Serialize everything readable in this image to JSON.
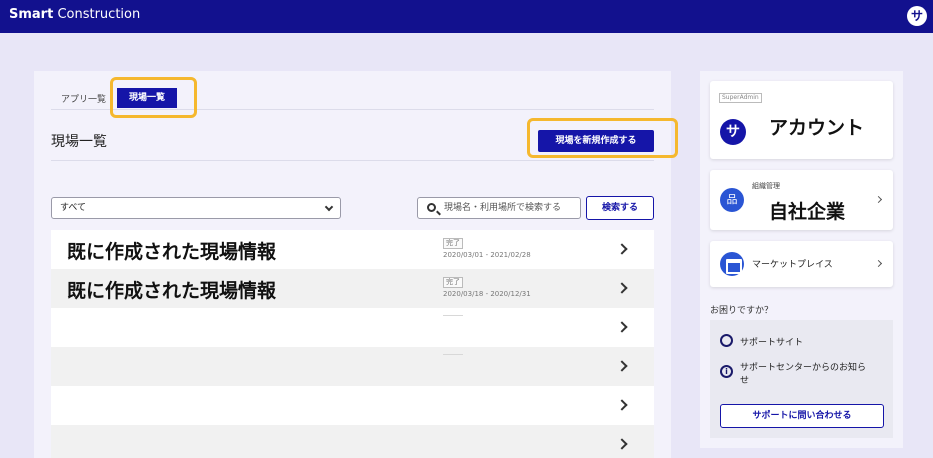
{
  "header": {
    "brand_bold": "Smart",
    "brand_rest": " Construction",
    "icon_char": "サ"
  },
  "tabs": [
    {
      "label": "アプリ一覧",
      "active": false
    },
    {
      "label": "現場一覧",
      "active": true
    }
  ],
  "page": {
    "title": "現場一覧",
    "create_button": "現場を新規作成する"
  },
  "filters": {
    "select_value": "すべて",
    "search_placeholder": "現場名・利用場所で検索する",
    "search_button": "検索する"
  },
  "sites": [
    {
      "name": "既に作成された現場情報",
      "status": "完了",
      "date_range": "2020/03/01 - 2021/02/28"
    },
    {
      "name": "既に作成された現場情報",
      "status": "完了",
      "date_range": "2020/03/18 - 2020/12/31"
    },
    {
      "name": "",
      "status": "",
      "date_range": ""
    },
    {
      "name": "",
      "status": "",
      "date_range": ""
    },
    {
      "name": "",
      "status": "",
      "date_range": ""
    },
    {
      "name": "",
      "status": "",
      "date_range": ""
    }
  ],
  "sidebar": {
    "account": {
      "role_badge": "SuperAdmin",
      "avatar_char": "サ",
      "name": "アカウント"
    },
    "org": {
      "label": "組織管理",
      "name": "自社企業",
      "icon_char": "品"
    },
    "marketplace": {
      "label": "マーケットプレイス"
    },
    "help": {
      "title": "お困りですか？",
      "support_site": "サポートサイト",
      "notice_line1": "サポートセンターからのお知ら",
      "notice_line2": "せ",
      "contact_button": "サポートに問い合わせる",
      "info_char": "i"
    }
  },
  "colors": {
    "primary": "#1515a8",
    "header": "#12118e",
    "highlight": "#f5b82e",
    "background": "#e8e6f7"
  }
}
